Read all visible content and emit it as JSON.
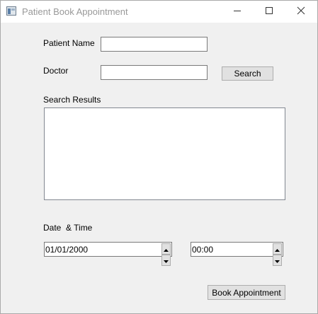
{
  "window": {
    "title": "Patient Book Appointment",
    "icon": "app-window-icon",
    "controls": [
      "minimize-icon",
      "maximize-icon",
      "close-icon"
    ]
  },
  "form": {
    "patient_name_label": "Patient Name",
    "patient_name_value": "",
    "doctor_label": "Doctor",
    "doctor_value": "",
    "search_button": "Search",
    "search_results_label": "Search Results",
    "search_results": [],
    "datetime_label": "Date  & Time",
    "date_value": "01/01/2000",
    "time_value": "00:00",
    "book_button": "Book Appointment"
  }
}
